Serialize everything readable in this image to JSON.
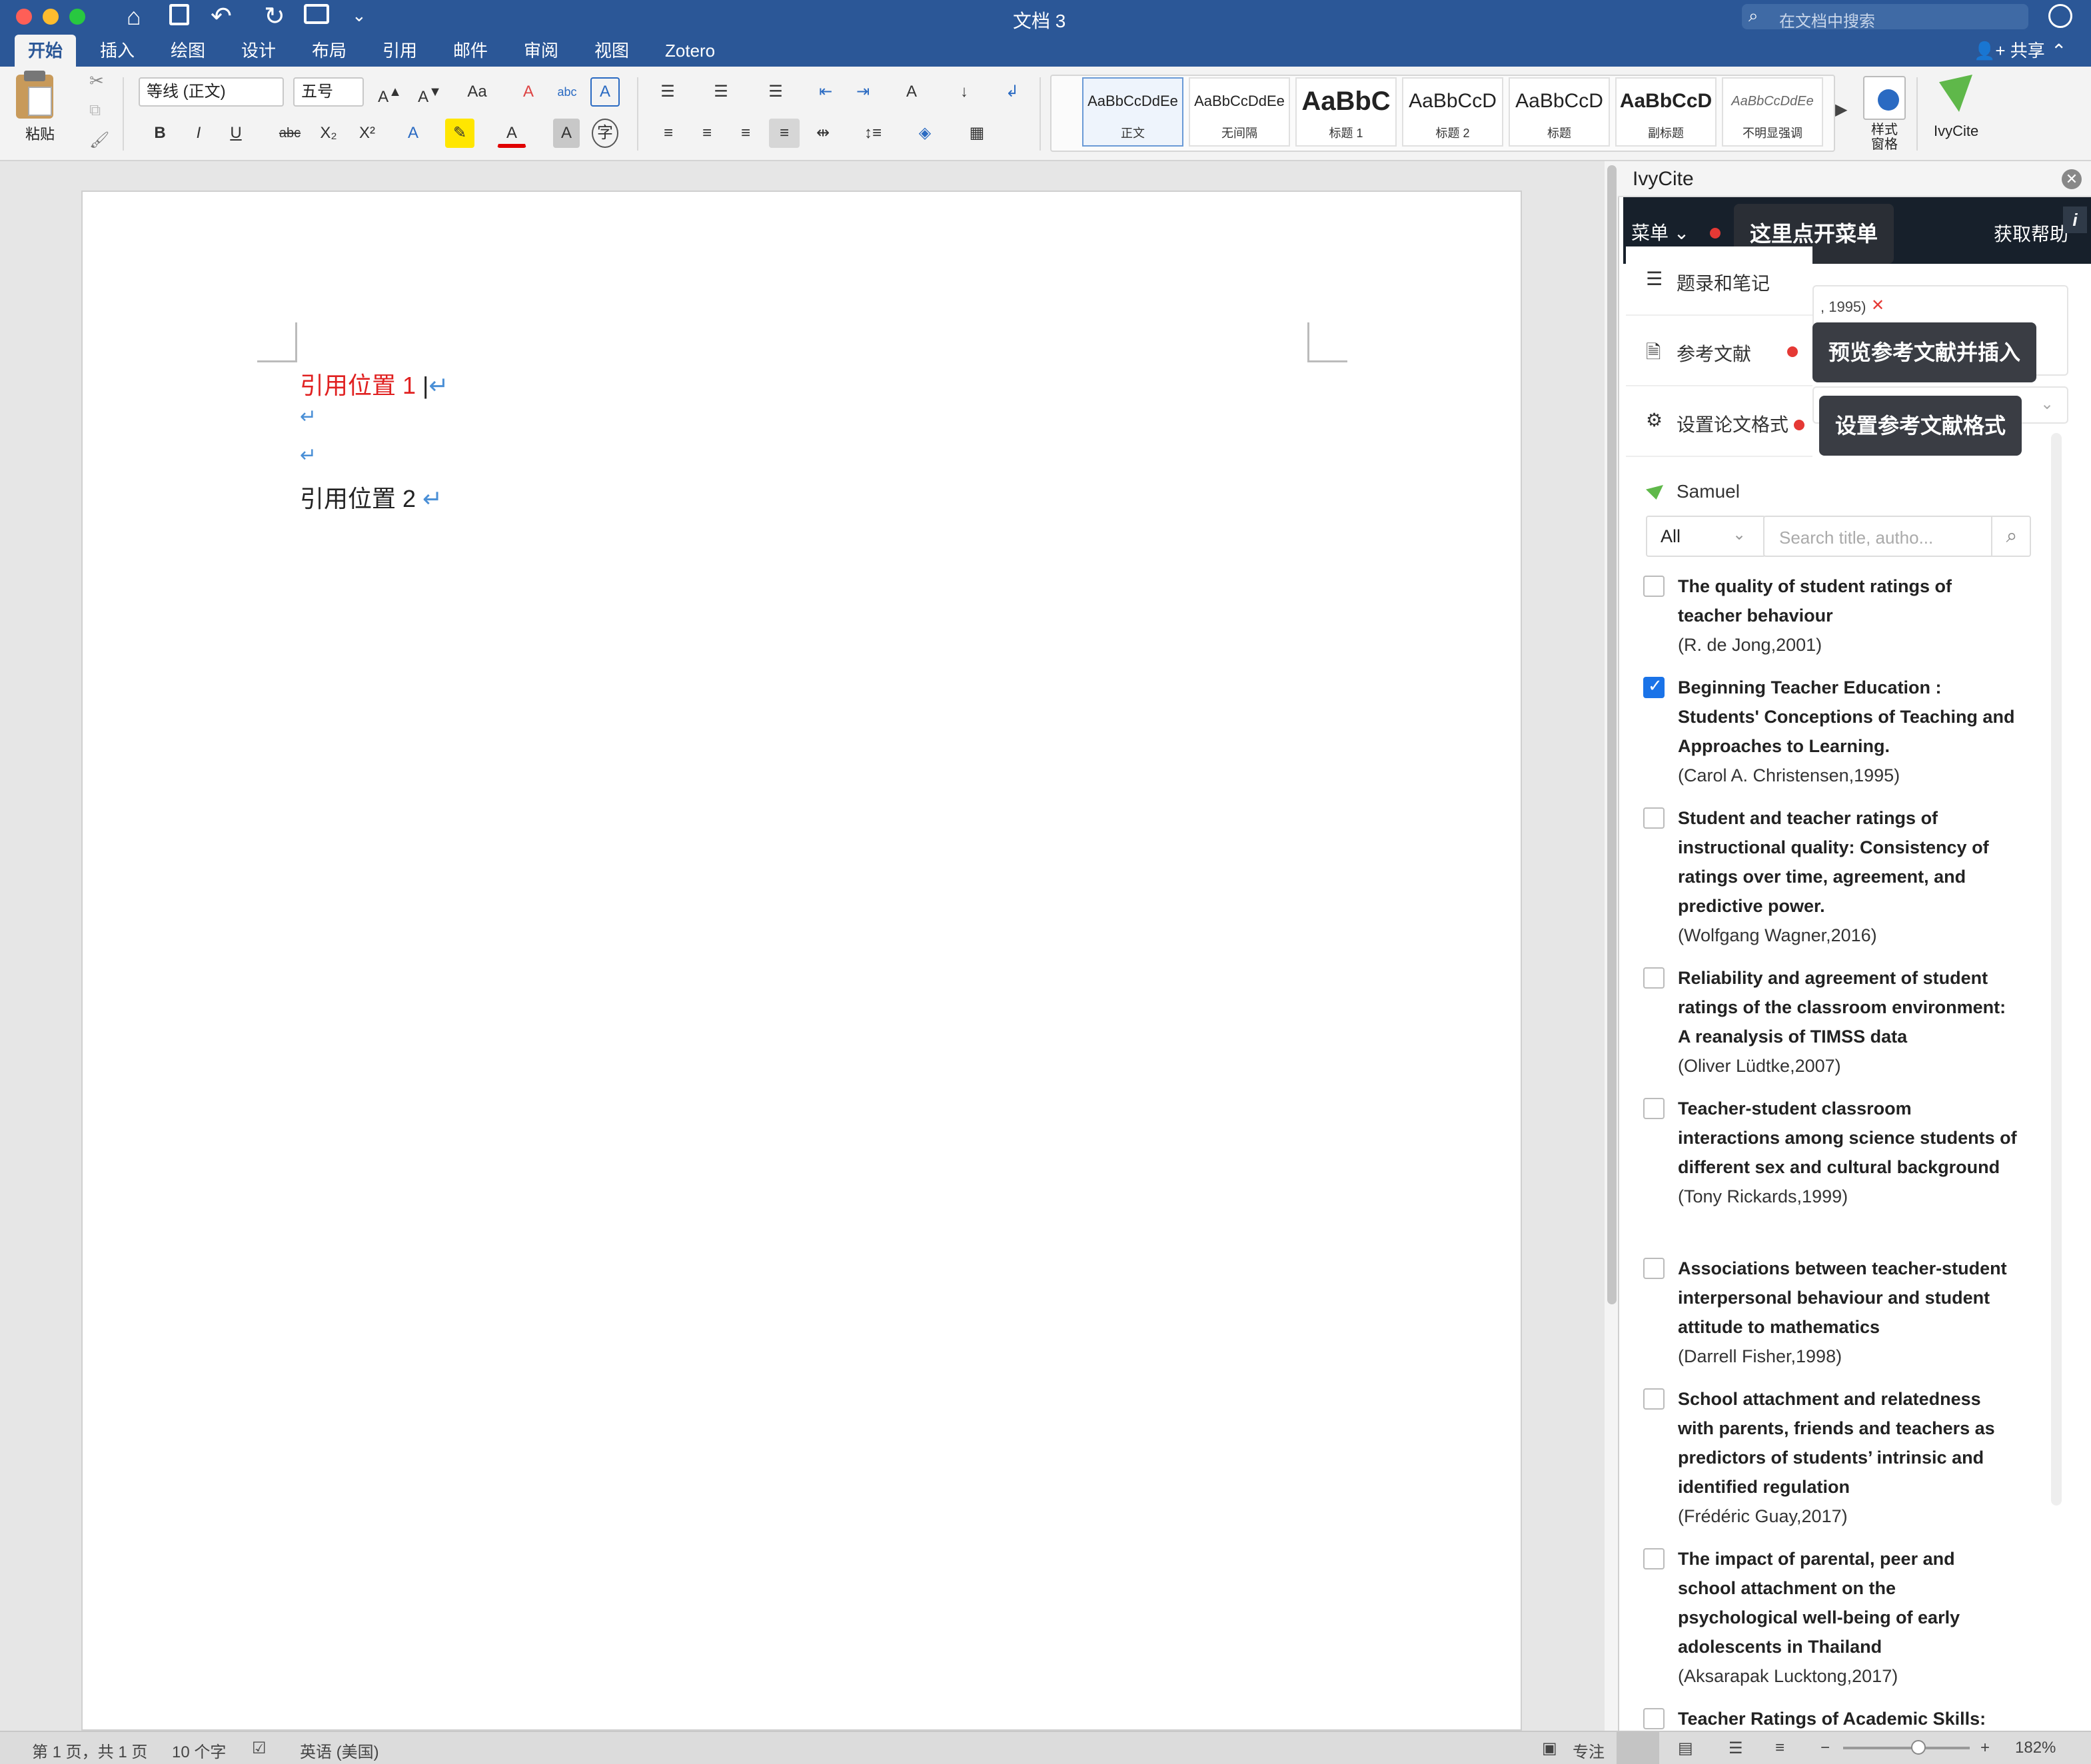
{
  "titlebar": {
    "title": "文档 3",
    "search_placeholder": "在文档中搜索"
  },
  "tabs": [
    {
      "label": "开始",
      "active": true
    },
    {
      "label": "插入"
    },
    {
      "label": "绘图"
    },
    {
      "label": "设计"
    },
    {
      "label": "布局"
    },
    {
      "label": "引用"
    },
    {
      "label": "邮件"
    },
    {
      "label": "审阅"
    },
    {
      "label": "视图"
    },
    {
      "label": "Zotero"
    }
  ],
  "share_label": "共享",
  "ribbon": {
    "paste_label": "粘贴",
    "font_name": "等线 (正文)",
    "font_size": "五号",
    "bold": "B",
    "italic": "I",
    "underline": "U",
    "strike": "abc",
    "subscript": "X₂",
    "superscript": "X²",
    "styles": [
      {
        "preview": "AaBbCcDdEe",
        "name": "正文"
      },
      {
        "preview": "AaBbCcDdEe",
        "name": "无间隔"
      },
      {
        "preview": "AaBbC",
        "name": "标题 1"
      },
      {
        "preview": "AaBbCcD",
        "name": "标题 2"
      },
      {
        "preview": "AaBbCcD",
        "name": "标题"
      },
      {
        "preview": "AaBbCcD",
        "name": "副标题"
      },
      {
        "preview": "AaBbCcDdEe",
        "name": "不明显强调"
      }
    ],
    "style_pane_label": "样式\n窗格",
    "ivycite_label": "IvyCite"
  },
  "document": {
    "line1": "引用位置 1",
    "line4": "引用位置 2",
    "pilcrow": "↵"
  },
  "pane": {
    "title": "IvyCite",
    "menu_label": "菜单",
    "help_label": "获取帮助",
    "tip_menu": "这里点开菜单",
    "menu_items": [
      {
        "label": "题录和笔记"
      },
      {
        "label": "参考文献"
      },
      {
        "label": "设置论文格式"
      }
    ],
    "tip_refs": "预览参考文献并插入",
    "tip_format": "设置参考文献格式",
    "citation_fragment": ", 1995)",
    "user": "Samuel",
    "filter_value": "All",
    "search_placeholder": "Search title, autho...",
    "references": [
      {
        "title": "The quality of student ratings of teacher behaviour",
        "author": "(R. de Jong,2001)",
        "checked": false
      },
      {
        "title": "Beginning Teacher Education : Students' Conceptions of Teaching and Approaches to Learning.",
        "author": "(Carol A. Christensen,1995)",
        "checked": true
      },
      {
        "title": "Student and teacher ratings of instructional quality: Consistency of ratings over time, agreement, and predictive power.",
        "author": "(Wolfgang Wagner,2016)",
        "checked": false
      },
      {
        "title": "Reliability and agreement of student ratings of the classroom environment: A reanalysis of TIMSS data",
        "author": "(Oliver Lüdtke,2007)",
        "checked": false
      },
      {
        "title": "Teacher-student classroom interactions among science students of different sex and cultural background",
        "author": "(Tony Rickards,1999)",
        "checked": false
      },
      {
        "title": "Associations between teacher-student interpersonal behaviour and student attitude to mathematics",
        "author": "(Darrell Fisher,1998)",
        "checked": false
      },
      {
        "title": "School attachment and relatedness with parents, friends and teachers as predictors of students’ intrinsic and identified regulation",
        "author": "(Frédéric Guay,2017)",
        "checked": false
      },
      {
        "title": "The impact of parental, peer and school attachment on the psychological well-being of early adolescents in Thailand",
        "author": "(Aksarapak Lucktong,2017)",
        "checked": false
      },
      {
        "title": "Teacher Ratings of Academic Skills:",
        "author": "",
        "checked": false
      }
    ]
  },
  "status": {
    "page_info": "第 1 页，共 1 页",
    "word_count": "10 个字",
    "language": "英语 (美国)",
    "focus_label": "专注",
    "zoom": "182%"
  }
}
